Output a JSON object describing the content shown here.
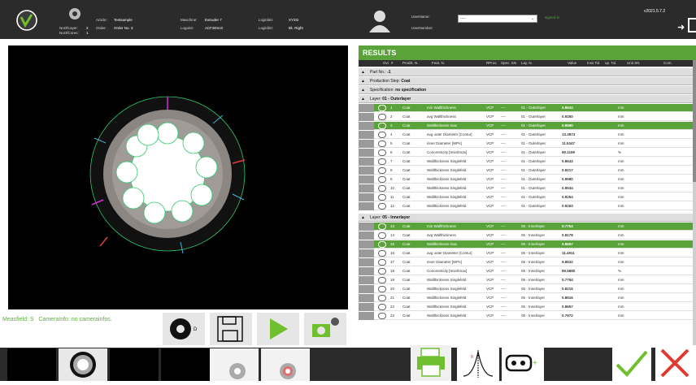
{
  "header": {
    "noOfLayer_label": "NoOfLayer:",
    "noOfLayer_value": "2",
    "noOfCores_label": "NoOfCores:",
    "noOfCores_value": "1",
    "article_label": "Article:",
    "article_value": "Testsample",
    "order_label": "Order:",
    "order_value": "Order No. 3",
    "machine_label": "Maschine:",
    "machine_value": "Extruder 7",
    "logoint_label": "Logoint:",
    "logoint_value": "ACF3Dnc0",
    "logicbit1_label": "LogicbitI:",
    "logicbit1_value": "XY2t2",
    "logicbit2_label": "LogicbitI:",
    "logicbit2_value": "8k. Right",
    "username_label": "UserName:",
    "usernumber_label": "UserNumber:",
    "user_select_value": "-----",
    "signed_in": "signed in",
    "version": "v2021.5.7.2"
  },
  "status": {
    "measfield_label": "Measfield:",
    "measfield_value": "S",
    "camerainfo_label": "CameraInfo:",
    "camerainfo_value": "no camerainfos."
  },
  "results": {
    "title": "RESULTS",
    "headers": [
      "Ovi",
      "#",
      "ProdS. N.",
      "Feat. N.",
      "RProv.",
      "Spec. SN",
      "Lay. N.",
      "Value",
      "Inss Tol.",
      "up. Tol.",
      "Unit SN",
      "Com."
    ],
    "part_label": "Part No.:",
    "part_value": "-1",
    "step_label": "Production Step:",
    "step_value": "Coat",
    "spec_label": "Specification:",
    "spec_value": "no specification",
    "layer1_label": "Layer:",
    "layer1_value": "01 - Outerlayer",
    "layer2_label": "Layer:",
    "layer2_value": "05 - Innerlayer",
    "rows1": [
      {
        "n": "1",
        "prod": "Coat",
        "feat": "min Wallthickness",
        "rprov": "VCP",
        "spec": "----",
        "lay": "01 - Outerlayer",
        "value": "0.8643",
        "unit": "mm",
        "hl": true
      },
      {
        "n": "2",
        "prod": "Coat",
        "feat": "avg Wallthickness",
        "rprov": "VCP",
        "spec": "----",
        "lay": "01 - Outerlayer",
        "value": "0.9250",
        "unit": "mm",
        "hl": false
      },
      {
        "n": "3",
        "prod": "Coat",
        "feat": "Wallthickness max",
        "rprov": "VCP",
        "spec": "----",
        "lay": "01 - Outerlayer",
        "value": "0.9590",
        "unit": "mm",
        "hl": true
      },
      {
        "n": "4",
        "prod": "Coat",
        "feat": "avg outer Diameter [Contur]",
        "rprov": "VCP",
        "spec": "----",
        "lay": "01 - Outerlayer",
        "value": "13.3874",
        "unit": "mm",
        "hl": false
      },
      {
        "n": "5",
        "prod": "Coat",
        "feat": "inner Diameter [WPs]",
        "rprov": "VCP",
        "spec": "----",
        "lay": "01 - Outerlayer",
        "value": "11.5347",
        "unit": "mm",
        "hl": false
      },
      {
        "n": "6",
        "prod": "Coat",
        "feat": "Concentricity [tmin/tmax]",
        "rprov": "VCP",
        "spec": "----",
        "lay": "01 - Outerlayer",
        "value": "90.1199",
        "unit": "%",
        "hl": false
      },
      {
        "n": "7",
        "prod": "Coat",
        "feat": "Wallthickness Singlefeld",
        "rprov": "VCP",
        "spec": "----",
        "lay": "01 - Outerlayer",
        "value": "0.8643",
        "unit": "mm",
        "hl": false
      },
      {
        "n": "8",
        "prod": "Coat",
        "feat": "Wallthickness Singlefeld",
        "rprov": "VCP",
        "spec": "----",
        "lay": "01 - Outerlayer",
        "value": "0.9217",
        "unit": "mm",
        "hl": false
      },
      {
        "n": "9",
        "prod": "Coat",
        "feat": "Wallthickness Singlefeld",
        "rprov": "VCP",
        "spec": "----",
        "lay": "01 - Outerlayer",
        "value": "0.9590",
        "unit": "mm",
        "hl": false
      },
      {
        "n": "10",
        "prod": "Coat",
        "feat": "Wallthickness Singlefeld",
        "rprov": "VCP",
        "spec": "----",
        "lay": "01 - Outerlayer",
        "value": "0.9534",
        "unit": "mm",
        "hl": false
      },
      {
        "n": "11",
        "prod": "Coat",
        "feat": "Wallthickness Singlefeld",
        "rprov": "VCP",
        "spec": "----",
        "lay": "01 - Outerlayer",
        "value": "0.9254",
        "unit": "mm",
        "hl": false
      },
      {
        "n": "12",
        "prod": "Coat",
        "feat": "Wallthickness Singlefeld",
        "rprov": "VCP",
        "spec": "----",
        "lay": "01 - Outerlayer",
        "value": "0.9263",
        "unit": "mm",
        "hl": false
      }
    ],
    "rows2": [
      {
        "n": "13",
        "prod": "Coat",
        "feat": "min Wallthickness",
        "rprov": "VCP",
        "spec": "----",
        "lay": "05 - Innerlayer",
        "value": "0.7754",
        "unit": "mm",
        "hl": true
      },
      {
        "n": "14",
        "prod": "Coat",
        "feat": "avg Wallthickness",
        "rprov": "VCP",
        "spec": "----",
        "lay": "05 - Innerlayer",
        "value": "0.8178",
        "unit": "mm",
        "hl": false
      },
      {
        "n": "15",
        "prod": "Coat",
        "feat": "Wallthickness max",
        "rprov": "VCP",
        "spec": "----",
        "lay": "05 - Innerlayer",
        "value": "0.8657",
        "unit": "mm",
        "hl": true
      },
      {
        "n": "16",
        "prod": "Coat",
        "feat": "avg outer Diameter [Contur]",
        "rprov": "VCP",
        "spec": "----",
        "lay": "05 - Innerlayer",
        "value": "11.4911",
        "unit": "mm",
        "hl": false
      },
      {
        "n": "17",
        "prod": "Coat",
        "feat": "inner Diameter [WPs]",
        "rprov": "VCP",
        "spec": "----",
        "lay": "05 - Innerlayer",
        "value": "9.8532",
        "unit": "mm",
        "hl": false
      },
      {
        "n": "18",
        "prod": "Coat",
        "feat": "Concentricity [tmin/tmax]",
        "rprov": "VCP",
        "spec": "----",
        "lay": "05 - Innerlayer",
        "value": "89.5680",
        "unit": "%",
        "hl": false
      },
      {
        "n": "19",
        "prod": "Coat",
        "feat": "Wallthickness Singlefeld",
        "rprov": "VCP",
        "spec": "----",
        "lay": "05 - Innerlayer",
        "value": "0.7754",
        "unit": "mm",
        "hl": false
      },
      {
        "n": "20",
        "prod": "Coat",
        "feat": "Wallthickness Singlefeld",
        "rprov": "VCP",
        "spec": "----",
        "lay": "05 - Innerlayer",
        "value": "0.8215",
        "unit": "mm",
        "hl": false
      },
      {
        "n": "21",
        "prod": "Coat",
        "feat": "Wallthickness Singlefeld",
        "rprov": "VCP",
        "spec": "----",
        "lay": "05 - Innerlayer",
        "value": "0.8616",
        "unit": "mm",
        "hl": false
      },
      {
        "n": "22",
        "prod": "Coat",
        "feat": "Wallthickness Singlefeld",
        "rprov": "VCP",
        "spec": "----",
        "lay": "05 - Innerlayer",
        "value": "0.8657",
        "unit": "mm",
        "hl": false
      },
      {
        "n": "23",
        "prod": "Coat",
        "feat": "Wallthickness Singlefeld",
        "rprov": "VCP",
        "spec": "----",
        "lay": "05 - Innerlayer",
        "value": "0.7972",
        "unit": "mm",
        "hl": false
      }
    ]
  },
  "icons": {
    "logo": "logo-icon",
    "sample": "sample-ring-icon",
    "user": "user-avatar-icon",
    "exit": "exit-icon",
    "diameter": "diameter-tool-icon",
    "save": "save-icon",
    "play": "play-icon",
    "camera": "camera-settings-icon",
    "print": "print-icon",
    "distribution": "distribution-icon",
    "layers": "layers-add-icon",
    "accept": "checkmark-icon",
    "reject": "close-icon"
  },
  "colors": {
    "accent": "#5aa33a",
    "dark": "#2b2b2b",
    "reject": "#e03a30",
    "accept": "#6fbf2f"
  }
}
